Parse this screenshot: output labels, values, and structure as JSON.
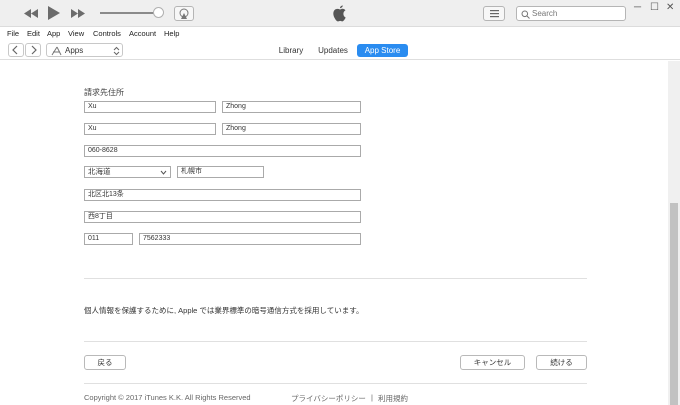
{
  "window": {
    "search_placeholder": "Search",
    "minimize_glyph": "─",
    "restore_glyph": "☐",
    "close_glyph": "✕"
  },
  "menu": [
    "File",
    "Edit",
    "App",
    "View",
    "Controls",
    "Account",
    "Help"
  ],
  "nav": {
    "media_label": "Apps",
    "tabs": [
      "Library",
      "Updates",
      "App Store"
    ],
    "active_tab": "App Store"
  },
  "form": {
    "section_title": "請求先住所",
    "last_name_reading": "Xu",
    "first_name_reading": "Zhong",
    "last_name": "Xu",
    "first_name": "Zhong",
    "postal_code": "060-8628",
    "prefecture": "北海道",
    "city": "札幌市",
    "address_line1": "北区北13条",
    "address_line2": "西8丁目",
    "phone_area": "011",
    "phone_number": "7562333"
  },
  "notice": "個人情報を保護するために, Apple では業界標準の暗号通信方式を採用しています。",
  "buttons": {
    "back": "戻る",
    "cancel": "キャンセル",
    "continue": "続ける"
  },
  "footer": {
    "copyright": "Copyright © 2017 iTunes K.K. All Rights Reserved",
    "privacy": "プライバシーポリシー",
    "separator": "|",
    "terms": "利用規約"
  },
  "colors": {
    "accent": "#2a8cf0",
    "toolbar_bg": "#efefef"
  }
}
